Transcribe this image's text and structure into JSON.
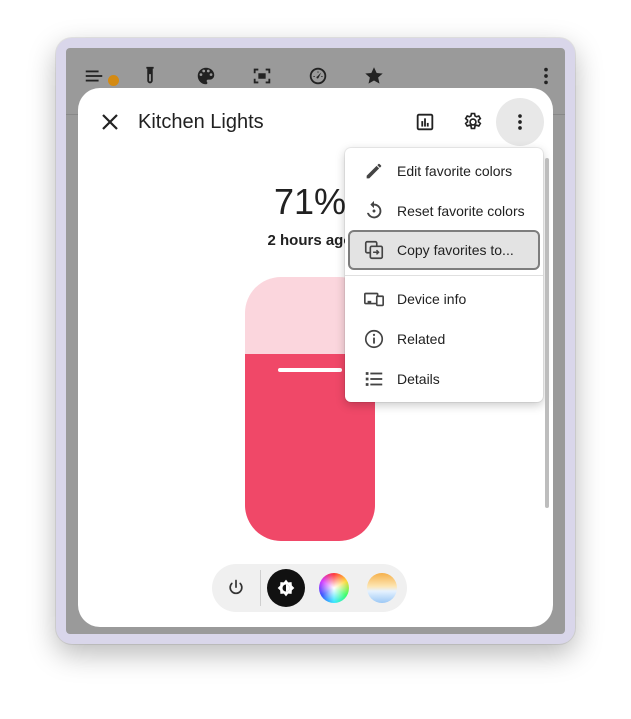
{
  "app_toolbar": {
    "icons": [
      "menu-icon",
      "test-tube-icon",
      "palette-icon",
      "screen-capture-icon",
      "gauge-icon",
      "star-icon",
      "more-vertical-icon"
    ],
    "notification_color": "#d48a12"
  },
  "dialog": {
    "title": "Kitchen Lights",
    "header_icons": [
      "history-chart-icon",
      "settings-gear-icon",
      "more-vertical-icon"
    ]
  },
  "light": {
    "brightness_text": "71%",
    "last_changed": "2 hours ago",
    "brightness_fraction": 0.71,
    "fill_color": "#f04868",
    "track_color": "#fbd6dd"
  },
  "controls": {
    "items": [
      "power-icon",
      "brightness-icon",
      "color-wheel-icon",
      "color-temperature-icon"
    ]
  },
  "menu": {
    "items": [
      {
        "label": "Edit favorite colors",
        "icon": "pencil-icon"
      },
      {
        "label": "Reset favorite colors",
        "icon": "reset-icon"
      },
      {
        "label": "Copy favorites to...",
        "icon": "copy-to-icon"
      },
      {
        "label": "Device info",
        "icon": "devices-icon"
      },
      {
        "label": "Related",
        "icon": "info-icon"
      },
      {
        "label": "Details",
        "icon": "list-icon"
      }
    ]
  }
}
